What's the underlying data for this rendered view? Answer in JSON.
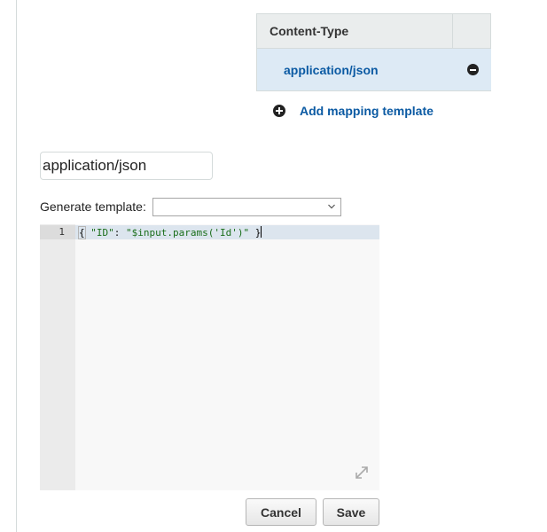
{
  "content_type_table": {
    "header": "Content-Type",
    "rows": [
      {
        "label": "application/json"
      }
    ],
    "add_label": "Add mapping template"
  },
  "content_type_input": {
    "value": "application/json"
  },
  "generate_template": {
    "label": "Generate template:",
    "selected": ""
  },
  "editor": {
    "lines": [
      {
        "number": "1",
        "open_brace": "{",
        "key": "\"ID\"",
        "colon": ": ",
        "value": "\"$input.params('Id')\"",
        "close_brace": " }"
      }
    ]
  },
  "buttons": {
    "cancel": "Cancel",
    "save": "Save"
  },
  "icons": {
    "remove": "minus-circle-icon",
    "add": "plus-circle-icon",
    "select": "chevron-down-icon",
    "resize": "resize-icon"
  },
  "colors": {
    "link": "#0b5aa3",
    "row_selected": "#ddeaf5",
    "header_bg": "#eaeded",
    "editor_bg": "#f8f8f8",
    "string": "#1a6e1a"
  }
}
